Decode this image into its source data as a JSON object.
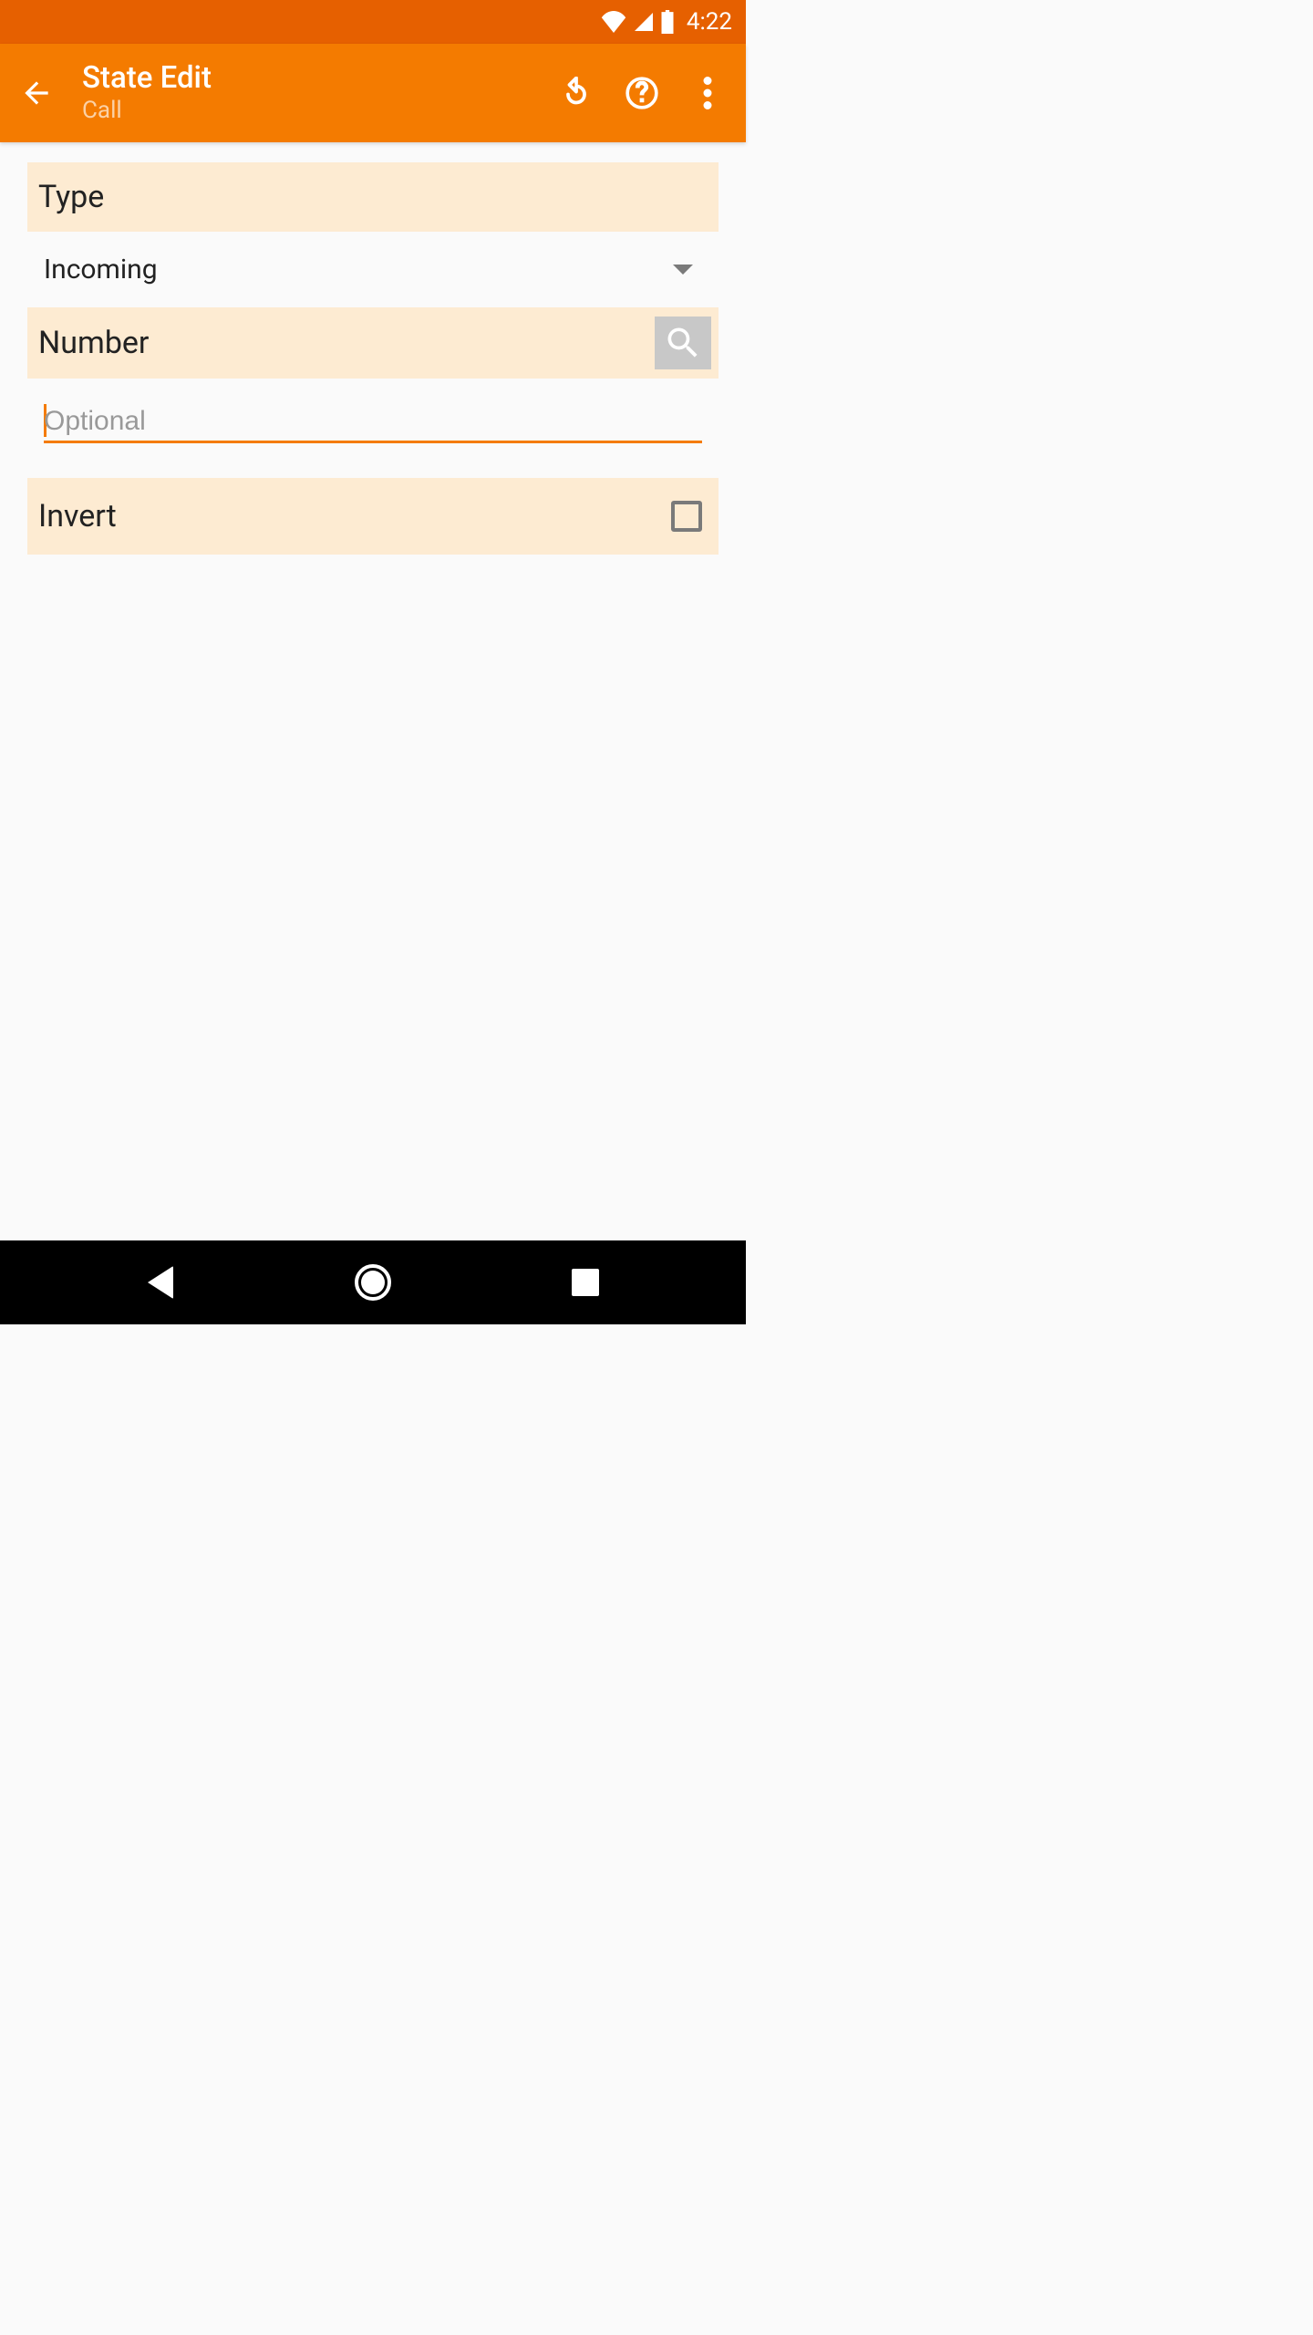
{
  "status_bar": {
    "time": "4:22"
  },
  "app_bar": {
    "title": "State Edit",
    "subtitle": "Call"
  },
  "sections": {
    "type": {
      "label": "Type",
      "value": "Incoming"
    },
    "number": {
      "label": "Number",
      "placeholder": "Optional",
      "value": ""
    },
    "invert": {
      "label": "Invert",
      "checked": false
    }
  }
}
